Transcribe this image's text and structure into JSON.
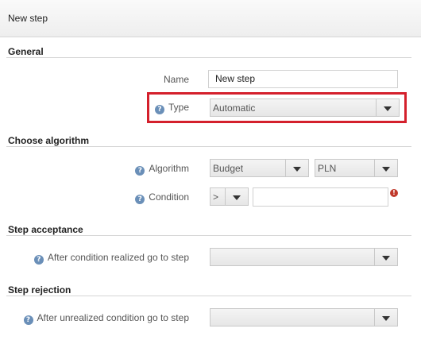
{
  "header": {
    "title": "New step"
  },
  "general": {
    "title": "General",
    "name_label": "Name",
    "name_value": "New step",
    "type_label": "Type",
    "type_value": "Automatic"
  },
  "algorithm": {
    "title": "Choose algorithm",
    "algorithm_label": "Algorithm",
    "algorithm_value": "Budget",
    "currency_value": "PLN",
    "condition_label": "Condition",
    "operator_value": ">",
    "condition_value": "",
    "error_icon": "!"
  },
  "acceptance": {
    "title": "Step acceptance",
    "goto_label": "After condition realized go to step",
    "goto_value": ""
  },
  "rejection": {
    "title": "Step rejection",
    "goto_label": "After unrealized condition go to step",
    "goto_value": ""
  },
  "icons": {
    "help": "?",
    "highlight_color": "#d4202c"
  }
}
